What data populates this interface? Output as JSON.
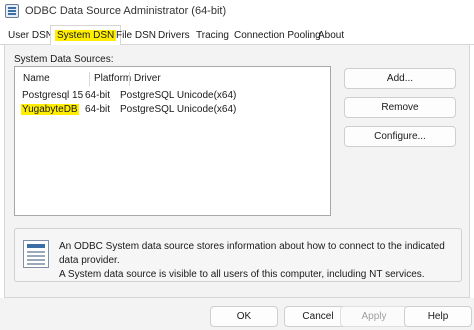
{
  "window": {
    "title": "ODBC Data Source Administrator (64-bit)",
    "icon": "odbc-app-icon"
  },
  "tabs": [
    {
      "label": "User DSN",
      "active": false
    },
    {
      "label": "System DSN",
      "active": true,
      "highlighted": true
    },
    {
      "label": "File DSN",
      "active": false
    },
    {
      "label": "Drivers",
      "active": false
    },
    {
      "label": "Tracing",
      "active": false
    },
    {
      "label": "Connection Pooling",
      "active": false
    },
    {
      "label": "About",
      "active": false
    }
  ],
  "system_dsn": {
    "section_label": "System Data Sources:",
    "columns": [
      "Name",
      "Platform",
      "Driver"
    ],
    "rows": [
      {
        "name": "Postgresql 15",
        "platform": "64-bit",
        "driver": "PostgreSQL Unicode(x64)",
        "highlighted": false
      },
      {
        "name": "YugabyteDB",
        "platform": "64-bit",
        "driver": "PostgreSQL Unicode(x64)",
        "highlighted": true
      }
    ],
    "buttons": {
      "add": "Add...",
      "remove": "Remove",
      "configure": "Configure..."
    },
    "info": {
      "icon": "data-source-icon",
      "line1": "An ODBC System data source stores information about how to connect to the indicated data provider.",
      "line2": "A System data source is visible to all users of this computer, including NT services."
    }
  },
  "footer": {
    "ok": "OK",
    "cancel": "Cancel",
    "apply": "Apply",
    "help": "Help"
  },
  "colors": {
    "highlight": "#ffee00",
    "panel_background": "#f3f3f3",
    "border": "#d6d6d6"
  }
}
